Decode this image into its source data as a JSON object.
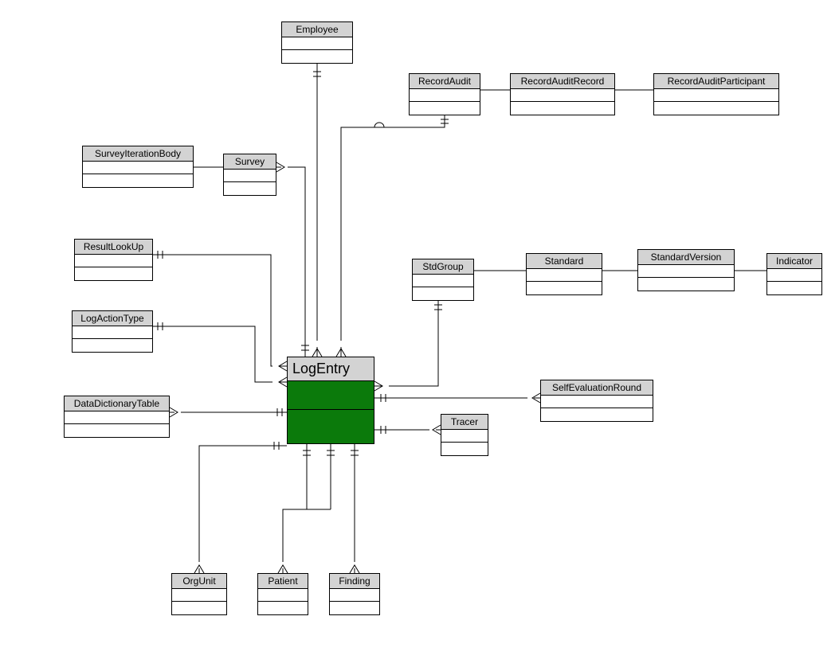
{
  "diagram": {
    "central": {
      "name": "LogEntry"
    },
    "entities": {
      "employee": "Employee",
      "recordAudit": "RecordAudit",
      "recordAuditRecord": "RecordAuditRecord",
      "recordAuditParticipant": "RecordAuditParticipant",
      "surveyIterationBody": "SurveyIterationBody",
      "survey": "Survey",
      "resultLookUp": "ResultLookUp",
      "stdGroup": "StdGroup",
      "standard": "Standard",
      "standardVersion": "StandardVersion",
      "indicator": "Indicator",
      "logActionType": "LogActionType",
      "dataDictionaryTable": "DataDictionaryTable",
      "selfEvaluationRound": "SelfEvaluationRound",
      "tracer": "Tracer",
      "orgUnit": "OrgUnit",
      "patient": "Patient",
      "finding": "Finding"
    }
  }
}
